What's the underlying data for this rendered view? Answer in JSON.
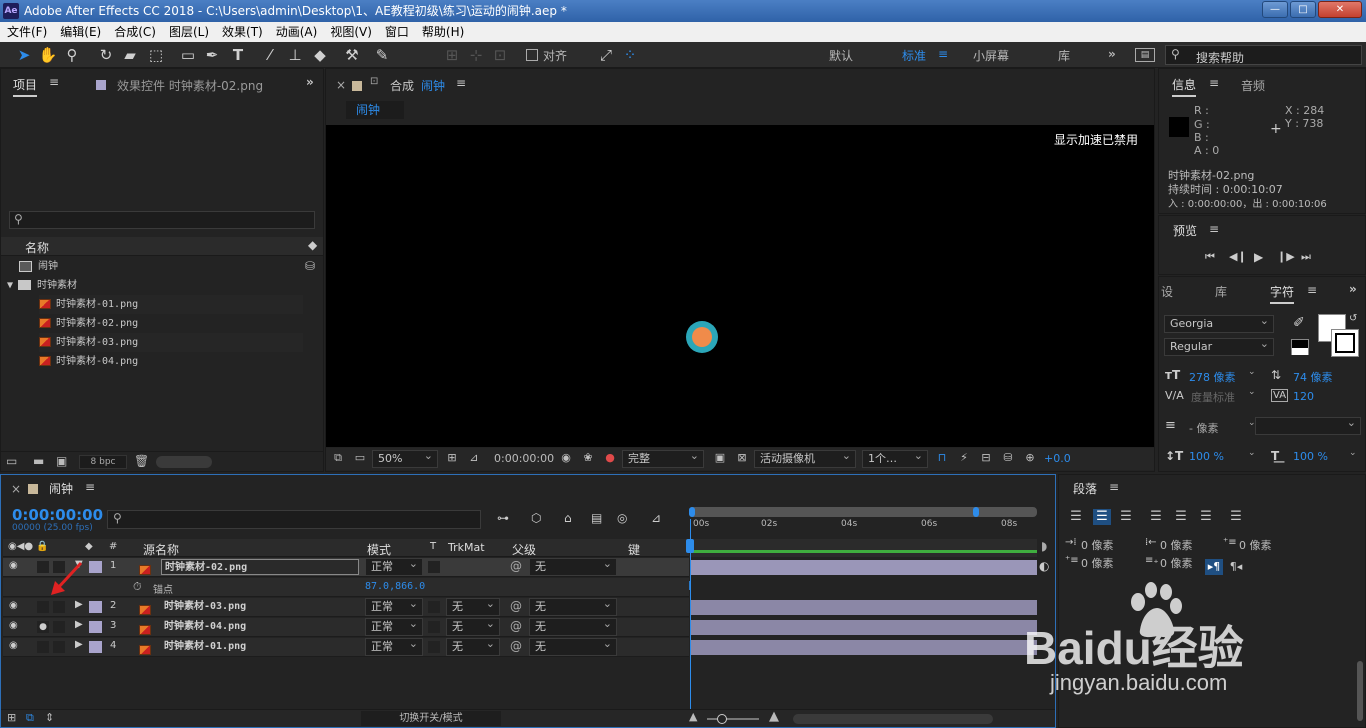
{
  "titlebar": {
    "app_icon": "Ae",
    "title": "Adobe After Effects CC 2018 - C:\\Users\\admin\\Desktop\\1、AE教程初级\\练习\\运动的闹钟.aep *",
    "minimize": "—",
    "maximize": "□",
    "close": "✕"
  },
  "menu": [
    "文件(F)",
    "编辑(E)",
    "合成(C)",
    "图层(L)",
    "效果(T)",
    "动画(A)",
    "视图(V)",
    "窗口",
    "帮助(H)"
  ],
  "toolbar": {
    "snap_label": "对齐",
    "workspaces": [
      "默认",
      "标准",
      "小屏幕",
      "库"
    ],
    "active_workspace": "标准",
    "more": "»",
    "search_placeholder": "搜索帮助"
  },
  "project_panel": {
    "tab_project": "项目",
    "tab_effects": "效果控件 时钟素材-02.png",
    "expand": "»",
    "col_name": "名称",
    "items": [
      {
        "type": "comp",
        "label": "闹钟"
      },
      {
        "type": "folder",
        "label": "时钟素材"
      },
      {
        "type": "png",
        "label": "时钟素材-01.png"
      },
      {
        "type": "png",
        "label": "时钟素材-02.png"
      },
      {
        "type": "png",
        "label": "时钟素材-03.png"
      },
      {
        "type": "png",
        "label": "时钟素材-04.png"
      }
    ],
    "bpc": "8 bpc"
  },
  "comp_panel": {
    "close": "×",
    "lock": "🔒",
    "tab_prefix": "合成",
    "tab_name": "闹钟",
    "breadcrumb": "闹钟",
    "accel_notice": "显示加速已禁用",
    "zoom": "50%",
    "timecode": "0:00:00:00",
    "resolution": "完整",
    "camera": "活动摄像机",
    "views": "1个…",
    "exposure": "+0.0",
    "circle_outer": "#2ba6b8",
    "circle_inner": "#f08b4a"
  },
  "info_panel": {
    "tab_info": "信息",
    "tab_audio": "音频",
    "r": "R :",
    "g": "G :",
    "b": "B :",
    "a": "A : 0",
    "x": "X : 284",
    "y": "Y : 738",
    "file": "时钟素材-02.png",
    "duration": "持续时间 : 0:00:10:07",
    "inout": "入 : 0:00:00:00，出 : 0:00:10:06"
  },
  "preview_panel": {
    "title": "预览"
  },
  "char_panel": {
    "tab_set": "设",
    "tab_lib": "库",
    "tab_char": "字符",
    "more": "»",
    "font": "Georgia",
    "style": "Regular",
    "size": "278 像素",
    "leading": "74 像素",
    "kerning": "度量标准",
    "tracking": "120",
    "stroke": "- 像素",
    "vscale": "100 %",
    "hscale": "100 %"
  },
  "para_panel": {
    "title": "段落",
    "indent_left": "0 像素",
    "indent_right": "0 像素",
    "indent_first": "0 像素",
    "space_before": "0 像素",
    "space_after": "0 像素"
  },
  "timeline": {
    "close": "×",
    "comp_name": "闹钟",
    "timecode": "0:00:00:00",
    "fps": "00000 (25.00 fps)",
    "col_name": "源名称",
    "col_mode": "模式",
    "col_t": "T",
    "col_trkmat": "TrkMat",
    "col_parent": "父级",
    "col_key": "键",
    "ticks": [
      "00s",
      "02s",
      "04s",
      "06s",
      "08s"
    ],
    "anchor_label": "锚点",
    "anchor_value": "87.0,866.0",
    "layers": [
      {
        "num": "1",
        "name": "时钟素材-02.png",
        "mode": "正常",
        "trkmat": "",
        "parent": "无"
      },
      {
        "num": "2",
        "name": "时钟素材-03.png",
        "mode": "正常",
        "trkmat": "无",
        "parent": "无"
      },
      {
        "num": "3",
        "name": "时钟素材-04.png",
        "mode": "正常",
        "trkmat": "无",
        "parent": "无"
      },
      {
        "num": "4",
        "name": "时钟素材-01.png",
        "mode": "正常",
        "trkmat": "无",
        "parent": "无"
      }
    ],
    "toggle_label": "切换开关/模式"
  },
  "watermark": {
    "brand": "Baidu经验",
    "url": "jingyan.baidu.com"
  }
}
